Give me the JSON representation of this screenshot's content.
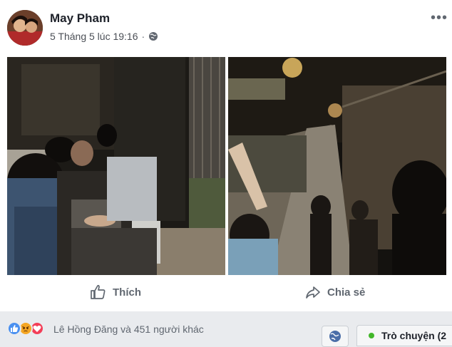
{
  "post": {
    "author": "May Pham",
    "timestamp": "5 Tháng 5 lúc 19:16",
    "separator": "·",
    "privacy_icon": "globe-icon",
    "more_label": "•••"
  },
  "actions": {
    "like_label": "Thích",
    "share_label": "Chia sẻ"
  },
  "reactions": {
    "icons": [
      "like-icon",
      "angry-icon",
      "love-icon"
    ],
    "summary": "Lê Hồng Đăng và 451 người khác"
  },
  "chat": {
    "label": "Trò chuyện (2",
    "status_color": "#42b72a"
  },
  "colors": {
    "like_reaction": "#4a90f0",
    "angry_reaction": "#f5a623",
    "love_reaction": "#f33e58"
  }
}
